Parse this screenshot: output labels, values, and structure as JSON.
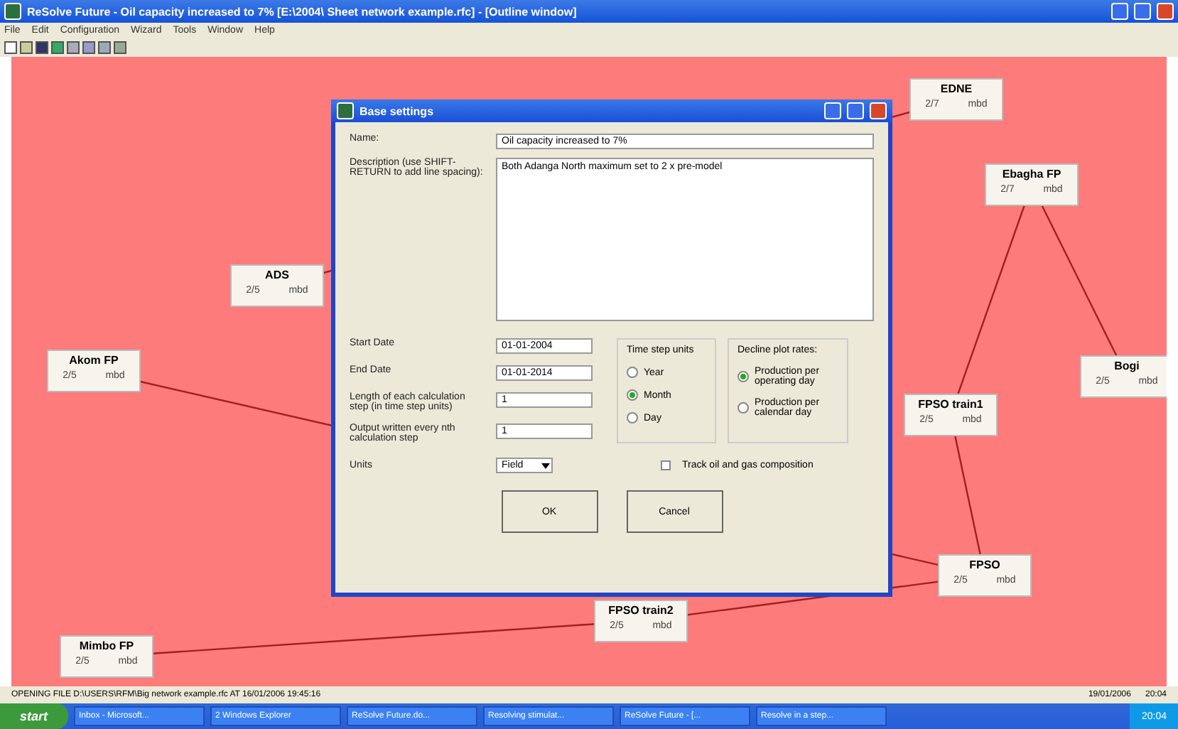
{
  "window": {
    "title": "ReSolve Future - Oil capacity increased to 7% [E:\\2004\\ Sheet network example.rfc] - [Outline window]"
  },
  "menu": [
    "File",
    "Edit",
    "Configuration",
    "Wizard",
    "Tools",
    "Window",
    "Help"
  ],
  "nodes": [
    {
      "name": "EDNE",
      "value": "2/7",
      "unit": "mbd"
    },
    {
      "name": "Ebagha FP",
      "value": "2/7",
      "unit": "mbd"
    },
    {
      "name": "ADS",
      "value": "2/5",
      "unit": "mbd"
    },
    {
      "name": "Akom FP",
      "value": "2/5",
      "unit": "mbd"
    },
    {
      "name": "Bogi",
      "value": "2/5",
      "unit": "mbd"
    },
    {
      "name": "FPSO train1",
      "value": "2/5",
      "unit": "mbd"
    },
    {
      "name": "FPSO",
      "value": "2/5",
      "unit": "mbd"
    },
    {
      "name": "FPSO train2",
      "value": "2/5",
      "unit": "mbd"
    },
    {
      "name": "Mimbo FP",
      "value": "2/5",
      "unit": "mbd"
    }
  ],
  "dialog": {
    "title": "Base settings",
    "name_label": "Name:",
    "name_value": "Oil capacity increased to 7%",
    "description_label": "Description (use SHIFT-RETURN to add line spacing):",
    "description_value": "Both Adanga North maximum set to 2 x pre-model",
    "fields": [
      {
        "label": "Start Date",
        "value": "01-01-2004"
      },
      {
        "label": "End Date",
        "value": "01-01-2014"
      },
      {
        "label": "Length of each calculation step (in time step units)",
        "value": "1"
      },
      {
        "label": "Output written every nth calculation step",
        "value": "1"
      }
    ],
    "units_label": "Units",
    "units_value": "Field",
    "time_step": {
      "title": "Time step units",
      "options": [
        {
          "label": "Year",
          "selected": false
        },
        {
          "label": "Month",
          "selected": true
        },
        {
          "label": "Day",
          "selected": false
        }
      ]
    },
    "decline": {
      "title": "Decline plot rates:",
      "options": [
        {
          "label": "Production per operating day",
          "selected": true
        },
        {
          "label": "Production per calendar day",
          "selected": false
        }
      ]
    },
    "track": {
      "label": "Track oil and gas composition",
      "checked": false
    },
    "buttons": [
      "OK",
      "Cancel"
    ]
  },
  "status_bar": {
    "message": "OPENING FILE D:\\USERS\\RFM\\Big network example.rfc AT 16/01/2006 19:45:16",
    "date": "19/01/2006",
    "time": "20:04"
  },
  "taskbar": {
    "start": "start",
    "items": [
      "Inbox - Microsoft...",
      "2 Windows Explorer",
      "ReSolve Future.do...",
      "Resolving stimulat...",
      "ReSolve Future - [...",
      "Resolve in a step..."
    ],
    "clock": "20:04"
  }
}
